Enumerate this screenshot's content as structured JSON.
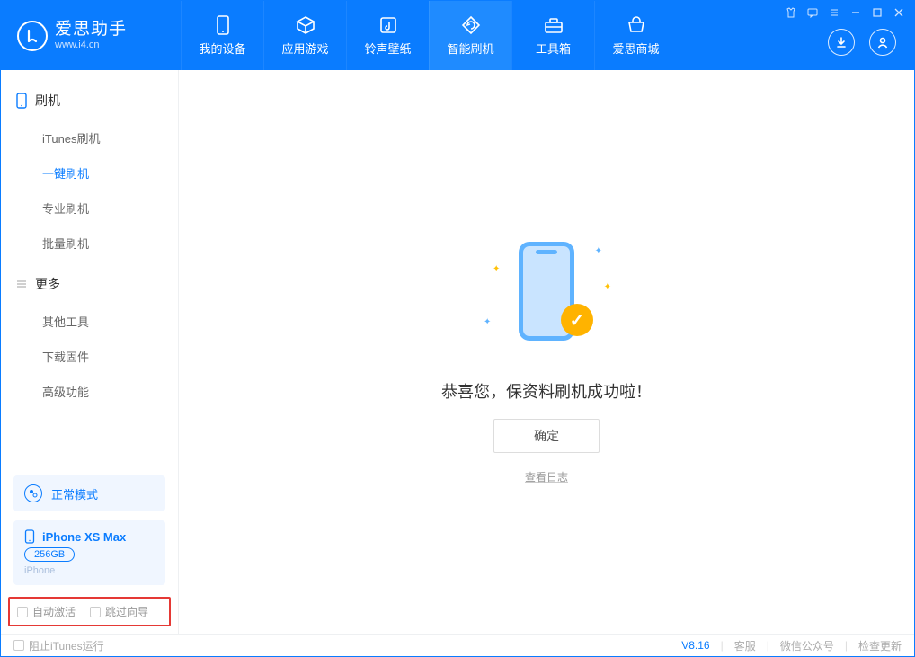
{
  "app": {
    "title": "爱思助手",
    "subtitle": "www.i4.cn"
  },
  "header_tabs": [
    {
      "label": "我的设备",
      "icon": "device-icon"
    },
    {
      "label": "应用游戏",
      "icon": "cube-icon"
    },
    {
      "label": "铃声壁纸",
      "icon": "music-icon"
    },
    {
      "label": "智能刷机",
      "icon": "refresh-icon",
      "active": true
    },
    {
      "label": "工具箱",
      "icon": "toolbox-icon"
    },
    {
      "label": "爱思商城",
      "icon": "store-icon"
    }
  ],
  "sidebar": {
    "sections": [
      {
        "title": "刷机",
        "icon": "phone-small-icon",
        "items": [
          {
            "label": "iTunes刷机"
          },
          {
            "label": "一键刷机",
            "active": true
          },
          {
            "label": "专业刷机"
          },
          {
            "label": "批量刷机"
          }
        ]
      },
      {
        "title": "更多",
        "icon": "menu-icon",
        "items": [
          {
            "label": "其他工具"
          },
          {
            "label": "下载固件"
          },
          {
            "label": "高级功能"
          }
        ]
      }
    ],
    "mode": {
      "label": "正常模式"
    },
    "device": {
      "name": "iPhone XS Max",
      "storage": "256GB",
      "type": "iPhone"
    },
    "checks": {
      "auto_activate": "自动激活",
      "skip_guide": "跳过向导"
    }
  },
  "main": {
    "success_text": "恭喜您，保资料刷机成功啦！",
    "ok_button": "确定",
    "log_link": "查看日志"
  },
  "footer": {
    "block_itunes": "阻止iTunes运行",
    "version": "V8.16",
    "links": [
      "客服",
      "微信公众号",
      "检查更新"
    ]
  }
}
